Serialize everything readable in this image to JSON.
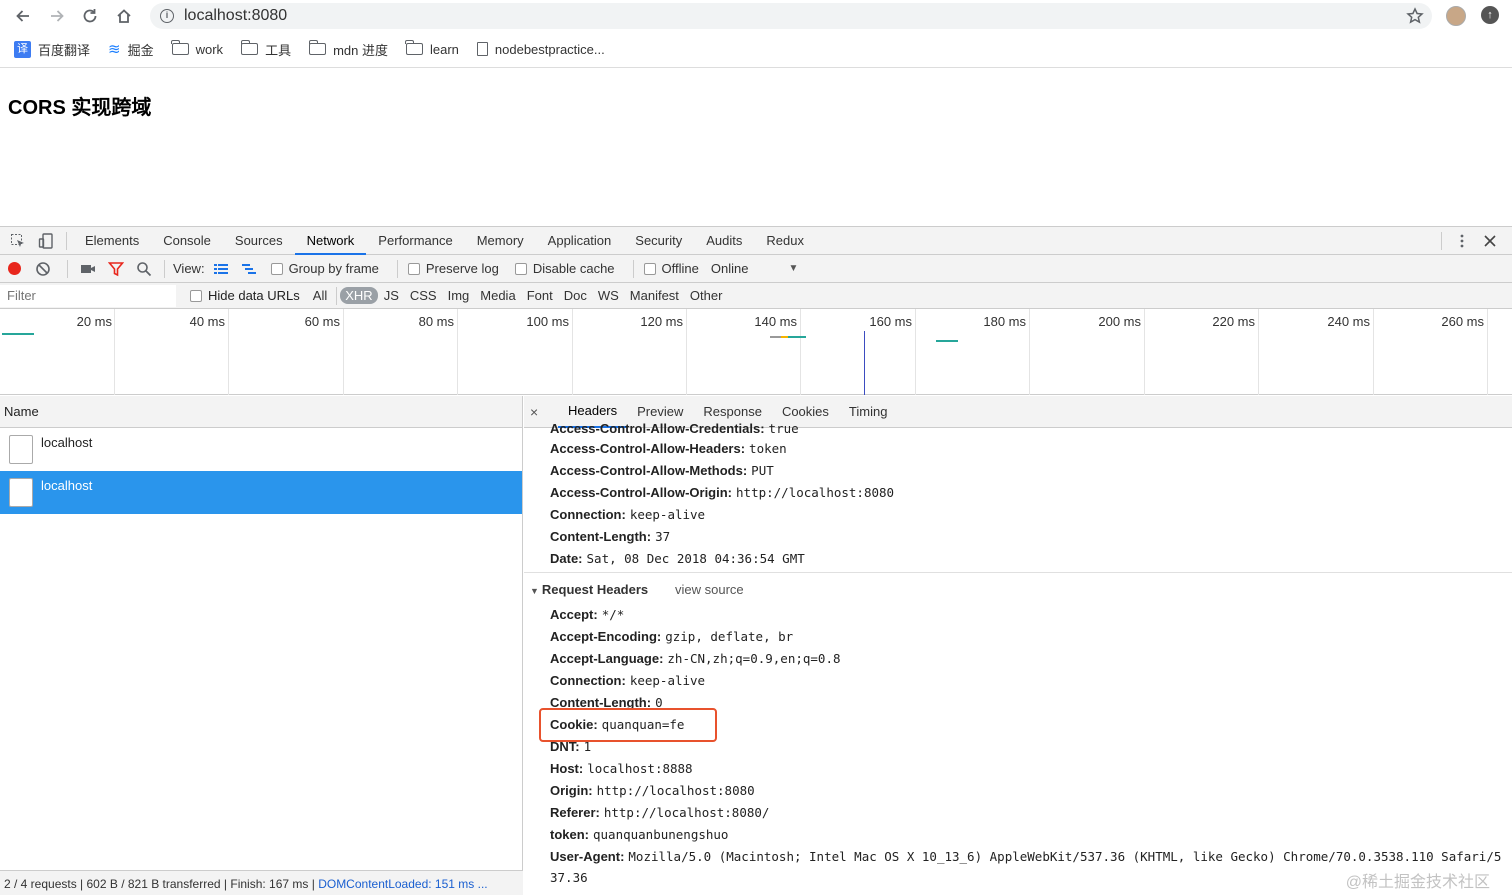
{
  "browser": {
    "url": "localhost:8080",
    "bookmarks": [
      {
        "label": "百度翻译",
        "icon": "translate-icon"
      },
      {
        "label": "掘金",
        "icon": "juejin-icon"
      },
      {
        "label": "work",
        "icon": "folder-icon"
      },
      {
        "label": "工具",
        "icon": "folder-icon"
      },
      {
        "label": "mdn 进度",
        "icon": "folder-icon"
      },
      {
        "label": "learn",
        "icon": "folder-icon"
      },
      {
        "label": "nodebestpractice...",
        "icon": "page-icon"
      }
    ]
  },
  "page": {
    "title": "CORS 实现跨域"
  },
  "devtools": {
    "tabs": [
      "Elements",
      "Console",
      "Sources",
      "Network",
      "Performance",
      "Memory",
      "Application",
      "Security",
      "Audits",
      "Redux"
    ],
    "active_tab": "Network",
    "toolbar": {
      "view_label": "View:",
      "group_by_frame": "Group by frame",
      "preserve_log": "Preserve log",
      "disable_cache": "Disable cache",
      "offline": "Offline",
      "throttle": "Online"
    },
    "filter": {
      "placeholder": "Filter",
      "hide_data_urls": "Hide data URLs",
      "types": [
        "All",
        "XHR",
        "JS",
        "CSS",
        "Img",
        "Media",
        "Font",
        "Doc",
        "WS",
        "Manifest",
        "Other"
      ],
      "active_type": "XHR"
    },
    "timeline_ticks": [
      "20 ms",
      "40 ms",
      "60 ms",
      "80 ms",
      "100 ms",
      "120 ms",
      "140 ms",
      "160 ms",
      "180 ms",
      "200 ms",
      "220 ms",
      "240 ms",
      "260 ms"
    ],
    "name_header": "Name",
    "requests": [
      {
        "name": "localhost",
        "selected": false
      },
      {
        "name": "localhost",
        "selected": true
      }
    ],
    "status": {
      "summary": "2 / 4 requests | 602 B / 821 B transferred | Finish: 167 ms | ",
      "dcl": "DOMContentLoaded: 151 ms ..."
    },
    "detail_tabs": [
      "Headers",
      "Preview",
      "Response",
      "Cookies",
      "Timing"
    ],
    "active_detail_tab": "Headers",
    "response_headers": [
      {
        "k": "Access-Control-Allow-Credentials:",
        "v": "true"
      },
      {
        "k": "Access-Control-Allow-Headers:",
        "v": "token"
      },
      {
        "k": "Access-Control-Allow-Methods:",
        "v": "PUT"
      },
      {
        "k": "Access-Control-Allow-Origin:",
        "v": "http://localhost:8080"
      },
      {
        "k": "Connection:",
        "v": "keep-alive"
      },
      {
        "k": "Content-Length:",
        "v": "37"
      },
      {
        "k": "Date:",
        "v": "Sat, 08 Dec 2018 04:36:54 GMT"
      }
    ],
    "request_section": {
      "title": "Request Headers",
      "view_source": "view source"
    },
    "request_headers": [
      {
        "k": "Accept:",
        "v": "*/*"
      },
      {
        "k": "Accept-Encoding:",
        "v": "gzip, deflate, br"
      },
      {
        "k": "Accept-Language:",
        "v": "zh-CN,zh;q=0.9,en;q=0.8"
      },
      {
        "k": "Connection:",
        "v": "keep-alive"
      },
      {
        "k": "Content-Length:",
        "v": "0"
      },
      {
        "k": "Cookie:",
        "v": "quanquan=fe"
      },
      {
        "k": "DNT:",
        "v": "1"
      },
      {
        "k": "Host:",
        "v": "localhost:8888"
      },
      {
        "k": "Origin:",
        "v": "http://localhost:8080"
      },
      {
        "k": "Referer:",
        "v": "http://localhost:8080/"
      },
      {
        "k": "token:",
        "v": "quanquanbunengshuo"
      },
      {
        "k": "User-Agent:",
        "v": "Mozilla/5.0 (Macintosh; Intel Mac OS X 10_13_6) AppleWebKit/537.36 (KHTML, like Gecko) Chrome/70.0.3538.110 Safari/5"
      },
      {
        "k": "",
        "v": "37.36"
      }
    ],
    "watermark": "@稀土掘金技术社区"
  }
}
